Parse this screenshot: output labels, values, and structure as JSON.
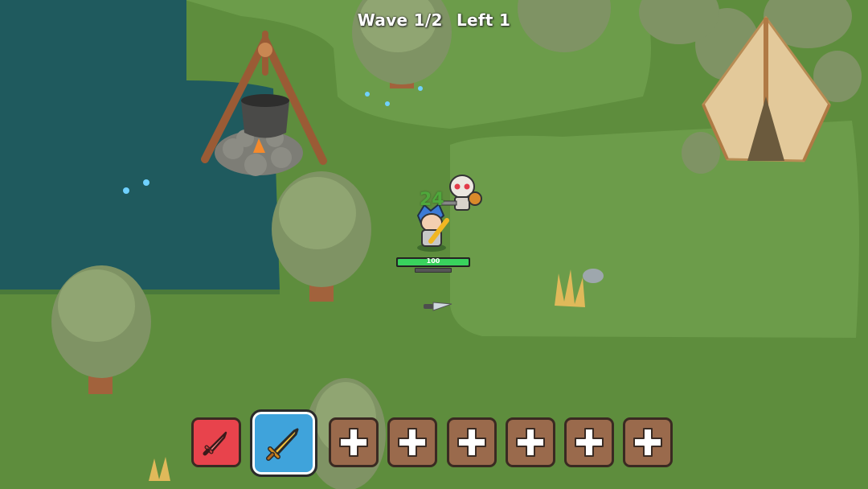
{
  "hud": {
    "wave_label": "Wave 1/2",
    "left_label": "Left 1"
  },
  "player": {
    "hp_text": "100",
    "hp_fraction": 1.0,
    "xp_fraction": 0.0,
    "damage_popup": "24"
  },
  "hotbar": {
    "slots": [
      {
        "type": "weapon",
        "icon": "red-sword-icon",
        "color": "#e8434c"
      },
      {
        "type": "weapon",
        "icon": "golden-sword-icon",
        "color": "#3fa3db",
        "selected": true
      },
      {
        "type": "empty",
        "icon": "plus-icon"
      },
      {
        "type": "empty",
        "icon": "plus-icon"
      },
      {
        "type": "empty",
        "icon": "plus-icon"
      },
      {
        "type": "empty",
        "icon": "plus-icon"
      },
      {
        "type": "empty",
        "icon": "plus-icon"
      },
      {
        "type": "empty",
        "icon": "plus-icon"
      }
    ]
  },
  "colors": {
    "grass": "#5f8f3e",
    "grass_light": "#6f9f4c",
    "water": "#1f5a5e",
    "empty_slot": "#9a6a4c"
  }
}
